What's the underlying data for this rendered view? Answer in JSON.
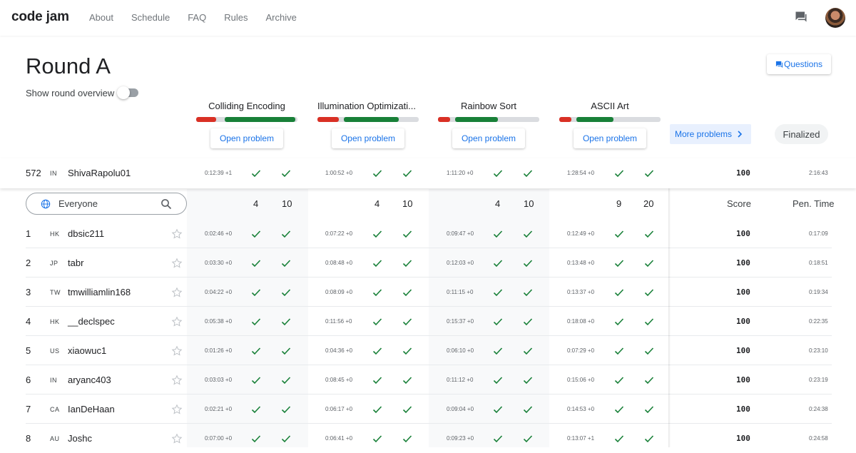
{
  "nav": {
    "logo": "code jam",
    "links": [
      "About",
      "Schedule",
      "FAQ",
      "Rules",
      "Archive"
    ],
    "chat_icon": "chat-bubble-icon",
    "avatar": "user-avatar"
  },
  "round": {
    "title": "Round A",
    "overview_label": "Show round overview",
    "overview_toggle": false,
    "questions_label": "Questions",
    "more_problems_label": "More problems",
    "status": "Finalized"
  },
  "problems": [
    {
      "name": "Colliding Encoding",
      "open_label": "Open problem",
      "pts_small": "4",
      "pts_large": "10"
    },
    {
      "name": "Illumination Optimizati...",
      "open_label": "Open problem",
      "pts_small": "4",
      "pts_large": "10"
    },
    {
      "name": "Rainbow Sort",
      "open_label": "Open problem",
      "pts_small": "4",
      "pts_large": "10"
    },
    {
      "name": "ASCII Art",
      "open_label": "Open problem",
      "pts_small": "9",
      "pts_large": "20"
    }
  ],
  "colors": {
    "red": "#d93025",
    "green": "#188038",
    "grey": "#dadce0",
    "blue": "#1a73e8"
  },
  "filter": {
    "placeholder": "Everyone",
    "score_header": "Score",
    "pen_time_header": "Pen. Time"
  },
  "my_row": {
    "rank": "572",
    "country": "IN",
    "name": "ShivaRapolu01",
    "times": [
      "0:12:39 +1",
      "1:00:52 +0",
      "1:11:20 +0",
      "1:28:54 +0"
    ],
    "score": "100",
    "pen_time": "2:16:43"
  },
  "rows": [
    {
      "rank": "1",
      "country": "HK",
      "name": "dbsic211",
      "times": [
        "0:02:46 +0",
        "0:07:22 +0",
        "0:09:47 +0",
        "0:12:49 +0"
      ],
      "score": "100",
      "pen_time": "0:17:09"
    },
    {
      "rank": "2",
      "country": "JP",
      "name": "tabr",
      "times": [
        "0:03:30 +0",
        "0:08:48 +0",
        "0:12:03 +0",
        "0:13:48 +0"
      ],
      "score": "100",
      "pen_time": "0:18:51"
    },
    {
      "rank": "3",
      "country": "TW",
      "name": "tmwilliamlin168",
      "times": [
        "0:04:22 +0",
        "0:08:09 +0",
        "0:11:15 +0",
        "0:13:37 +0"
      ],
      "score": "100",
      "pen_time": "0:19:34"
    },
    {
      "rank": "4",
      "country": "HK",
      "name": "__declspec",
      "times": [
        "0:05:38 +0",
        "0:11:56 +0",
        "0:15:37 +0",
        "0:18:08 +0"
      ],
      "score": "100",
      "pen_time": "0:22:35"
    },
    {
      "rank": "5",
      "country": "US",
      "name": "xiaowuc1",
      "times": [
        "0:01:26 +0",
        "0:04:36 +0",
        "0:06:10 +0",
        "0:07:29 +0"
      ],
      "score": "100",
      "pen_time": "0:23:10"
    },
    {
      "rank": "6",
      "country": "IN",
      "name": "aryanc403",
      "times": [
        "0:03:03 +0",
        "0:08:45 +0",
        "0:11:12 +0",
        "0:15:06 +0"
      ],
      "score": "100",
      "pen_time": "0:23:19"
    },
    {
      "rank": "7",
      "country": "CA",
      "name": "IanDeHaan",
      "times": [
        "0:02:21 +0",
        "0:06:17 +0",
        "0:09:04 +0",
        "0:14:53 +0"
      ],
      "score": "100",
      "pen_time": "0:24:38"
    },
    {
      "rank": "8",
      "country": "AU",
      "name": "Joshc",
      "times": [
        "0:07:00 +0",
        "0:06:41 +0",
        "0:09:23 +0",
        "0:13:07 +1"
      ],
      "score": "100",
      "pen_time": "0:24:58"
    }
  ]
}
